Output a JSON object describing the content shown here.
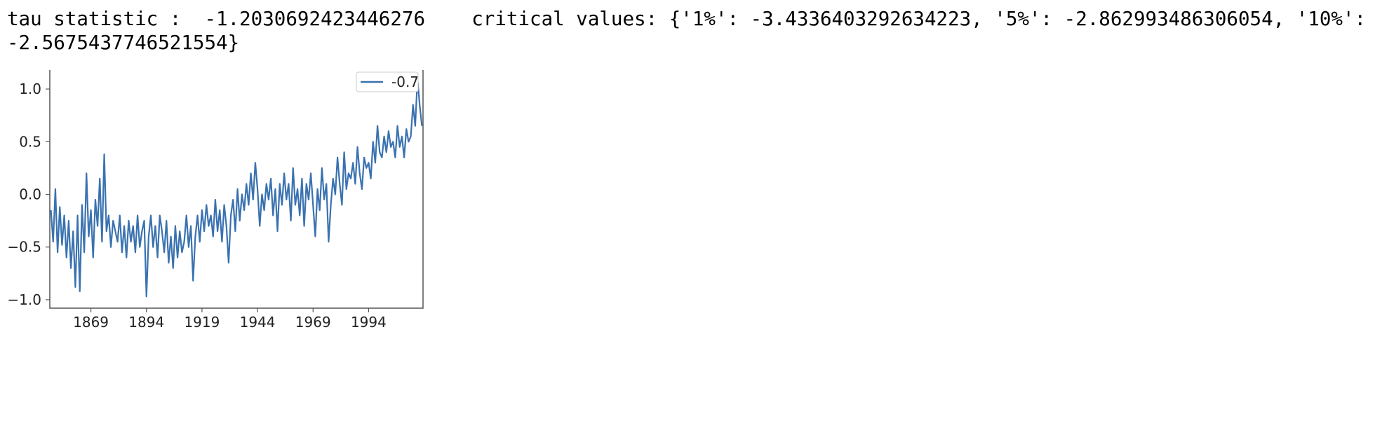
{
  "output": {
    "text": "tau statistic :  -1.2030692423446276    critical values: {'1%': -3.4336403292634223, '5%': -2.862993486306054, '10%': -2.5675437746521554}"
  },
  "colors": {
    "series": "#3a72b0",
    "frame": "#555555",
    "tick_text": "#222222"
  },
  "chart_data": {
    "type": "line",
    "title": "",
    "xlabel": "",
    "ylabel": "",
    "xlim": [
      1850.5,
      2018.5
    ],
    "ylim": [
      -1.08,
      1.22
    ],
    "xticks": [
      1869,
      1894,
      1919,
      1944,
      1969,
      1994
    ],
    "xtick_labels": [
      "1869",
      "1894",
      "1919",
      "1944",
      "1969",
      "1994"
    ],
    "yticks": [
      1.0,
      0.5,
      0.0,
      -0.5,
      -1.0
    ],
    "ytick_labels": [
      "1.0",
      "0.5",
      "0.0",
      "−0.5",
      "−1.0"
    ],
    "legend": {
      "placement": "top-right",
      "entries": [
        "-0.7"
      ]
    },
    "grid": false,
    "series": [
      {
        "name": "-0.7",
        "x": [
          1851,
          1852,
          1853,
          1854,
          1855,
          1856,
          1857,
          1858,
          1859,
          1860,
          1861,
          1862,
          1863,
          1864,
          1865,
          1866,
          1867,
          1868,
          1869,
          1870,
          1871,
          1872,
          1873,
          1874,
          1875,
          1876,
          1877,
          1878,
          1879,
          1880,
          1881,
          1882,
          1883,
          1884,
          1885,
          1886,
          1887,
          1888,
          1889,
          1890,
          1891,
          1892,
          1893,
          1894,
          1895,
          1896,
          1897,
          1898,
          1899,
          1900,
          1901,
          1902,
          1903,
          1904,
          1905,
          1906,
          1907,
          1908,
          1909,
          1910,
          1911,
          1912,
          1913,
          1914,
          1915,
          1916,
          1917,
          1918,
          1919,
          1920,
          1921,
          1922,
          1923,
          1924,
          1925,
          1926,
          1927,
          1928,
          1929,
          1930,
          1931,
          1932,
          1933,
          1934,
          1935,
          1936,
          1937,
          1938,
          1939,
          1940,
          1941,
          1942,
          1943,
          1944,
          1945,
          1946,
          1947,
          1948,
          1949,
          1950,
          1951,
          1952,
          1953,
          1954,
          1955,
          1956,
          1957,
          1958,
          1959,
          1960,
          1961,
          1962,
          1963,
          1964,
          1965,
          1966,
          1967,
          1968,
          1969,
          1970,
          1971,
          1972,
          1973,
          1974,
          1975,
          1976,
          1977,
          1978,
          1979,
          1980,
          1981,
          1982,
          1983,
          1984,
          1985,
          1986,
          1987,
          1988,
          1989,
          1990,
          1991,
          1992,
          1993,
          1994,
          1995,
          1996,
          1997,
          1998,
          1999,
          2000,
          2001,
          2002,
          2003,
          2004,
          2005,
          2006,
          2007,
          2008,
          2009,
          2010,
          2011,
          2012,
          2013,
          2014,
          2015,
          2016,
          2017,
          2018
        ],
        "y": [
          -0.15,
          -0.45,
          0.05,
          -0.55,
          -0.12,
          -0.48,
          -0.2,
          -0.6,
          -0.25,
          -0.7,
          -0.35,
          -0.88,
          -0.2,
          -0.92,
          -0.1,
          -0.55,
          0.2,
          -0.4,
          -0.15,
          -0.6,
          -0.05,
          -0.3,
          0.15,
          -0.45,
          0.38,
          -0.35,
          -0.2,
          -0.5,
          -0.25,
          -0.35,
          -0.45,
          -0.2,
          -0.55,
          -0.3,
          -0.6,
          -0.25,
          -0.45,
          -0.3,
          -0.55,
          -0.2,
          -0.5,
          -0.35,
          -0.25,
          -0.97,
          -0.4,
          -0.2,
          -0.5,
          -0.3,
          -0.6,
          -0.2,
          -0.35,
          -0.55,
          -0.25,
          -0.65,
          -0.4,
          -0.7,
          -0.3,
          -0.6,
          -0.35,
          -0.55,
          -0.45,
          -0.2,
          -0.5,
          -0.3,
          -0.82,
          -0.4,
          -0.2,
          -0.45,
          -0.15,
          -0.35,
          -0.1,
          -0.3,
          -0.2,
          -0.4,
          -0.05,
          -0.35,
          -0.15,
          -0.45,
          -0.1,
          -0.3,
          -0.65,
          -0.2,
          -0.05,
          -0.35,
          0.05,
          -0.25,
          0.0,
          -0.15,
          0.1,
          -0.1,
          0.2,
          -0.05,
          0.3,
          0.05,
          -0.3,
          0.0,
          -0.15,
          0.1,
          -0.05,
          0.15,
          -0.2,
          0.05,
          -0.35,
          0.1,
          -0.1,
          0.2,
          -0.05,
          0.1,
          -0.25,
          0.25,
          -0.1,
          0.05,
          -0.2,
          0.15,
          -0.3,
          0.1,
          -0.05,
          0.2,
          -0.1,
          -0.4,
          0.05,
          -0.15,
          0.25,
          -0.05,
          0.1,
          -0.45,
          -0.1,
          0.15,
          0.0,
          0.35,
          0.1,
          -0.1,
          0.4,
          0.05,
          0.2,
          0.15,
          0.3,
          0.1,
          0.45,
          0.2,
          0.05,
          0.35,
          0.25,
          0.3,
          0.15,
          0.5,
          0.3,
          0.65,
          0.4,
          0.35,
          0.55,
          0.4,
          0.6,
          0.45,
          0.5,
          0.35,
          0.65,
          0.45,
          0.55,
          0.35,
          0.62,
          0.5,
          0.55,
          0.85,
          0.65,
          1.1,
          0.85,
          0.65
        ]
      }
    ]
  }
}
